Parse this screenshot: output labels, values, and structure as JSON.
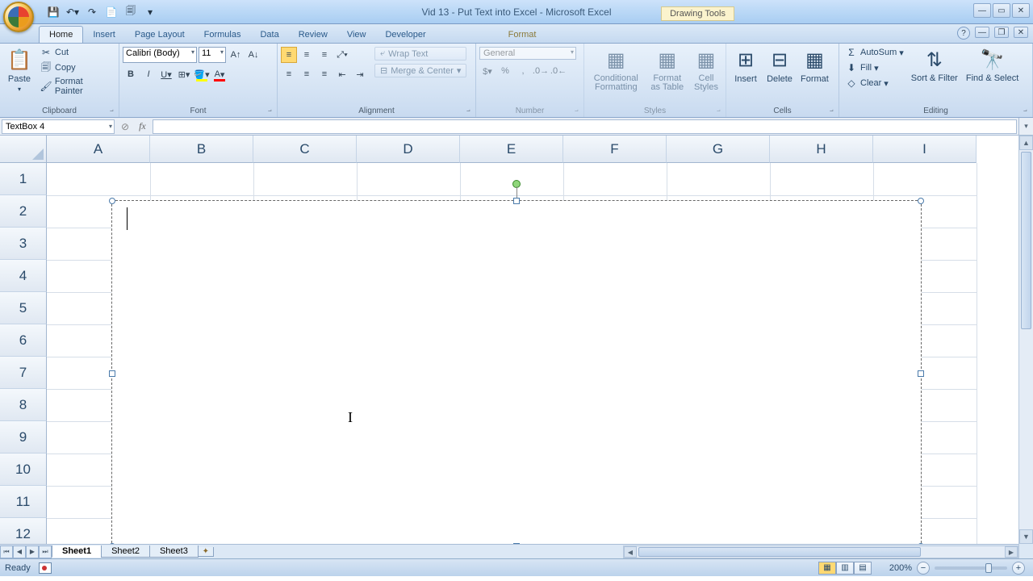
{
  "titlebar": {
    "doc_title": "Vid 13 - Put Text into Excel - Microsoft Excel",
    "contextual_label": "Drawing Tools"
  },
  "tabs": {
    "home": "Home",
    "insert": "Insert",
    "page_layout": "Page Layout",
    "formulas": "Formulas",
    "data": "Data",
    "review": "Review",
    "view": "View",
    "developer": "Developer",
    "format": "Format"
  },
  "ribbon": {
    "clipboard": {
      "label": "Clipboard",
      "paste": "Paste",
      "cut": "Cut",
      "copy": "Copy",
      "format_painter": "Format Painter"
    },
    "font": {
      "label": "Font",
      "family": "Calibri (Body)",
      "size": "11"
    },
    "alignment": {
      "label": "Alignment",
      "wrap": "Wrap Text",
      "merge": "Merge & Center"
    },
    "number": {
      "label": "Number",
      "format": "General"
    },
    "styles": {
      "label": "Styles",
      "cond": "Conditional Formatting",
      "table": "Format as Table",
      "cell": "Cell Styles"
    },
    "cells": {
      "label": "Cells",
      "insert": "Insert",
      "delete": "Delete",
      "format": "Format"
    },
    "editing": {
      "label": "Editing",
      "autosum": "AutoSum",
      "fill": "Fill",
      "clear": "Clear",
      "sort": "Sort & Filter",
      "find": "Find & Select"
    }
  },
  "name_box": "TextBox 4",
  "columns": [
    "A",
    "B",
    "C",
    "D",
    "E",
    "F",
    "G",
    "H",
    "I"
  ],
  "rows": [
    "1",
    "2",
    "3",
    "4",
    "5",
    "6",
    "7",
    "8",
    "9",
    "10",
    "11",
    "12"
  ],
  "sheet_tabs": [
    "Sheet1",
    "Sheet2",
    "Sheet3"
  ],
  "status": {
    "text": "Ready",
    "zoom": "200%"
  }
}
